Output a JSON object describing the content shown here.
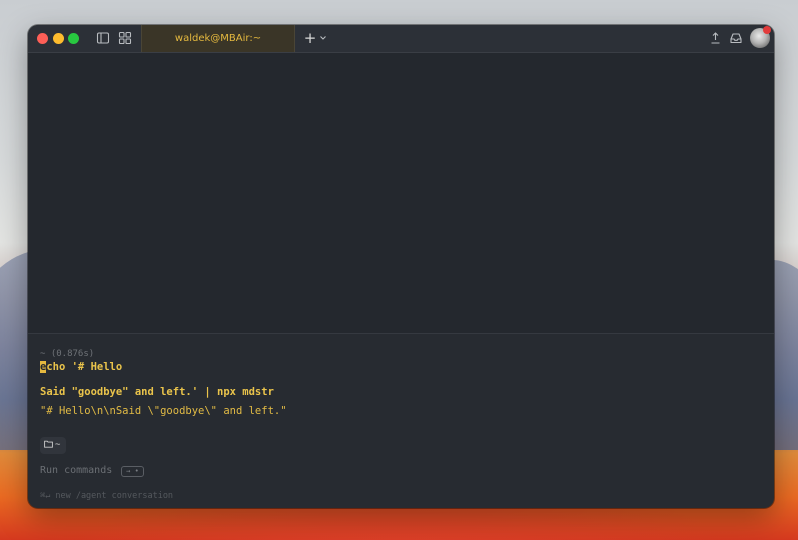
{
  "window": {
    "tab_title": "waldek@MBAir:~",
    "new_tab_label": "+"
  },
  "terminal": {
    "prompt_meta": "~ (0.876s)",
    "command_first_char": "e",
    "command_line1_rest": "cho '# Hello",
    "command_line2": "Said \"goodbye\" and left.' | npx mdstr",
    "output": "\"# Hello\\n\\nSaid \\\"goodbye\\\" and left.\"",
    "dir_chip_label": "~",
    "input_placeholder": "Run commands",
    "key_badge": "→ •",
    "hint": "⌘↵ new /agent conversation"
  },
  "icons": {
    "sidebar": "sidebar-toggle-icon",
    "grid": "grid-icon",
    "chevron": "chevron-down-icon",
    "upload": "upload-icon",
    "inbox": "inbox-icon",
    "folder": "folder-icon"
  },
  "colors": {
    "accent": "#e5b93f",
    "window_bg": "#272b31",
    "titlebar_bg": "#2c3037",
    "close": "#fe5f57",
    "minimize": "#febc2e",
    "zoom": "#28c840"
  }
}
